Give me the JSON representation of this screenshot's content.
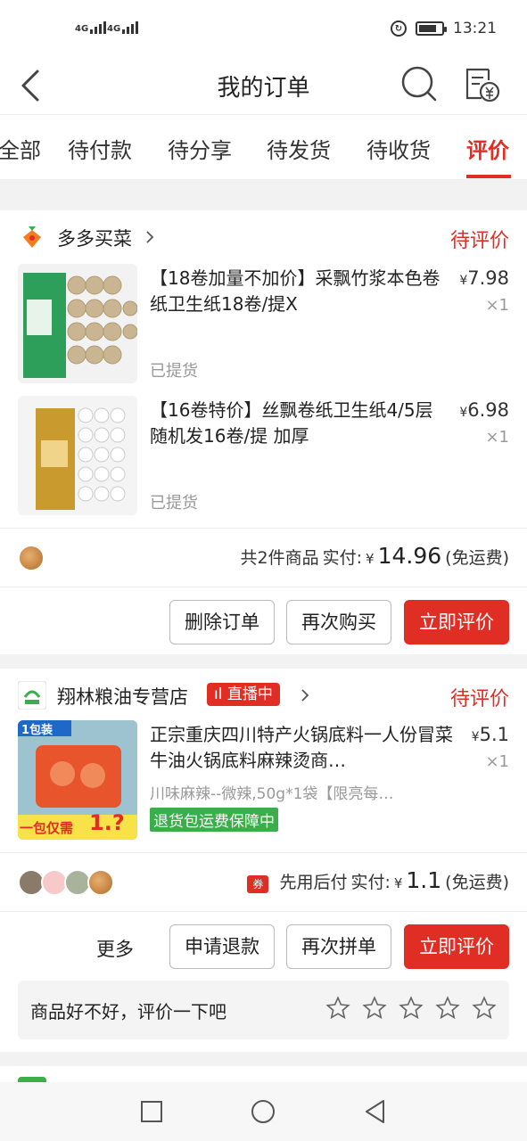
{
  "status_bar": {
    "signal1": "4G",
    "signal2": "4G",
    "time": "13:21"
  },
  "header": {
    "title": "我的订单"
  },
  "tabs": [
    {
      "label": "全部"
    },
    {
      "label": "待付款"
    },
    {
      "label": "待分享"
    },
    {
      "label": "待发货"
    },
    {
      "label": "待收货"
    },
    {
      "label": "评价"
    }
  ],
  "orders": [
    {
      "shop": "多多买菜",
      "status": "待评价",
      "items": [
        {
          "title": "【18卷加量不加价】采飘竹浆本色卷纸卫生纸18卷/提X",
          "price": "7.98",
          "currency": "¥",
          "qty": "×1",
          "tag": "已提货"
        },
        {
          "title": "【16卷特价】丝飘卷纸卫生纸4/5层随机发16卷/提 加厚",
          "price": "6.98",
          "currency": "¥",
          "qty": "×1",
          "tag": "已提货"
        }
      ],
      "summary": {
        "count": "共2件商品",
        "paid_label": "实付:",
        "currency": "¥",
        "amount": "14.96",
        "shipping": "(免运费)"
      },
      "buttons": {
        "delete": "删除订单",
        "rebuy": "再次购买",
        "review": "立即评价"
      }
    },
    {
      "shop": "翔林粮油专营店",
      "live": "直播中",
      "status": "待评价",
      "items": [
        {
          "title": "正宗重庆四川特产火锅底料一人份冒菜牛油火锅底料麻辣烫商…",
          "price": "5.1",
          "currency": "¥",
          "qty": "×1",
          "spec": "川味麻辣--微辣,50g*1袋【限亮每…",
          "guarantee": "退货包运费保障中",
          "thumb_badge": "1包装",
          "thumb_caption": "一包仅需",
          "thumb_price": "1.?"
        }
      ],
      "summary": {
        "coupon": "券",
        "pay_later": "先用后付",
        "paid_label": "实付:",
        "currency": "¥",
        "amount": "1.1",
        "shipping": "(免运费)"
      },
      "buttons": {
        "more": "更多",
        "refund": "申请退款",
        "regroup": "再次拼单",
        "review": "立即评价"
      },
      "rate_prompt": "商品好不好，评价一下吧",
      "stars": 5
    }
  ],
  "colors": {
    "accent": "#e02e24",
    "green": "#3aae4b"
  }
}
